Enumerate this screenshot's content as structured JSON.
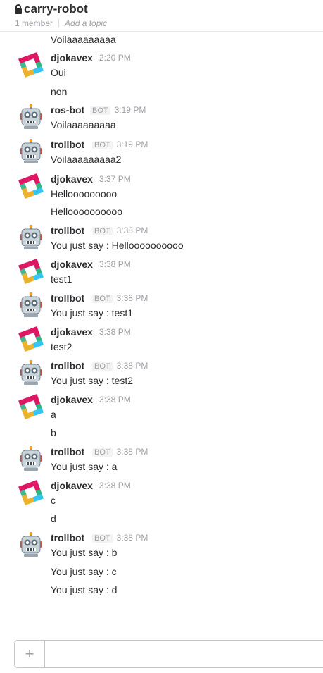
{
  "header": {
    "channel_name": "carry-robot",
    "member_count": "1 member",
    "topic_placeholder": "Add a topic"
  },
  "messages": {
    "m0_cont": "Voilaaaaaaaaa",
    "m1": {
      "author": "djokavex",
      "time": "2:20 PM",
      "text": "Oui",
      "avatar": "slack-logo-avatar"
    },
    "m1_cont": "non",
    "m2": {
      "author": "ros-bot",
      "badge": "BOT",
      "time": "3:19 PM",
      "text": "Voilaaaaaaaaa",
      "avatar": "robot-avatar"
    },
    "m3": {
      "author": "trollbot",
      "badge": "BOT",
      "time": "3:19 PM",
      "text": "Voilaaaaaaaaa2",
      "avatar": "robot-avatar"
    },
    "m4": {
      "author": "djokavex",
      "time": "3:37 PM",
      "text": "Hellooooooooo",
      "avatar": "slack-logo-avatar"
    },
    "m4_cont": "Helloooooooooo",
    "m5": {
      "author": "trollbot",
      "badge": "BOT",
      "time": "3:38 PM",
      "text": "You just say : Helloooooooooo",
      "avatar": "robot-avatar"
    },
    "m6": {
      "author": "djokavex",
      "time": "3:38 PM",
      "text": "test1",
      "avatar": "slack-logo-avatar"
    },
    "m7": {
      "author": "trollbot",
      "badge": "BOT",
      "time": "3:38 PM",
      "text": "You just say : test1",
      "avatar": "robot-avatar"
    },
    "m8": {
      "author": "djokavex",
      "time": "3:38 PM",
      "text": "test2",
      "avatar": "slack-logo-avatar"
    },
    "m9": {
      "author": "trollbot",
      "badge": "BOT",
      "time": "3:38 PM",
      "text": "You just say : test2",
      "avatar": "robot-avatar"
    },
    "m10": {
      "author": "djokavex",
      "time": "3:38 PM",
      "text": "a",
      "avatar": "slack-logo-avatar"
    },
    "m10_cont": "b",
    "m11": {
      "author": "trollbot",
      "badge": "BOT",
      "time": "3:38 PM",
      "text": "You just say : a",
      "avatar": "robot-avatar"
    },
    "m12": {
      "author": "djokavex",
      "time": "3:38 PM",
      "text": "c",
      "avatar": "slack-logo-avatar"
    },
    "m12_cont": "d",
    "m13": {
      "author": "trollbot",
      "badge": "BOT",
      "time": "3:38 PM",
      "text": "You just say : b",
      "avatar": "robot-avatar"
    },
    "m13_cont1": "You just say : c",
    "m13_cont2": "You just say : d"
  },
  "composer": {
    "plus_label": "+",
    "input_value": ""
  }
}
